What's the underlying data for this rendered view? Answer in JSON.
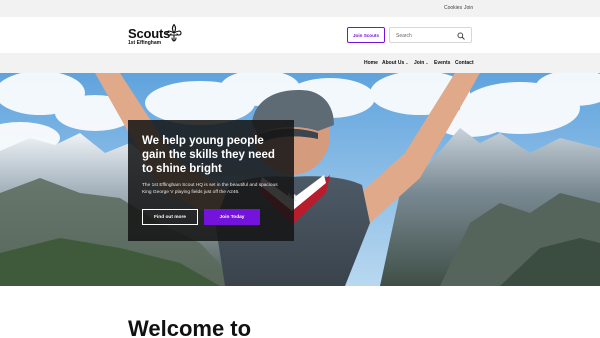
{
  "utility_bar": {
    "cookies": "Cookies",
    "join": "Join"
  },
  "header": {
    "logo_text": "Scouts",
    "group_name": "1st Effingham",
    "logo_icon": "fleur-de-lis-icon",
    "join_button": "Join Scouts",
    "search_placeholder": "Search",
    "search_icon": "search-icon"
  },
  "nav": {
    "items": [
      {
        "label": "Home"
      },
      {
        "label": "About Us",
        "has_dropdown": true
      },
      {
        "label": "Join",
        "has_dropdown": true
      },
      {
        "label": "Events"
      },
      {
        "label": "Contact"
      }
    ]
  },
  "hero": {
    "heading": "We help young people gain the skills they need to shine bright",
    "body": "The 1st Effingham Scout HQ is set in the beautiful and spacious King George V playing fields just off the A246.",
    "primary_button": "Find out more",
    "secondary_button": "Join Today"
  },
  "welcome": {
    "heading": "Welcome to"
  },
  "colors": {
    "brand_purple": "#7413dc",
    "utility_bg": "#f2f2f2",
    "hero_card_bg": "#141414"
  }
}
